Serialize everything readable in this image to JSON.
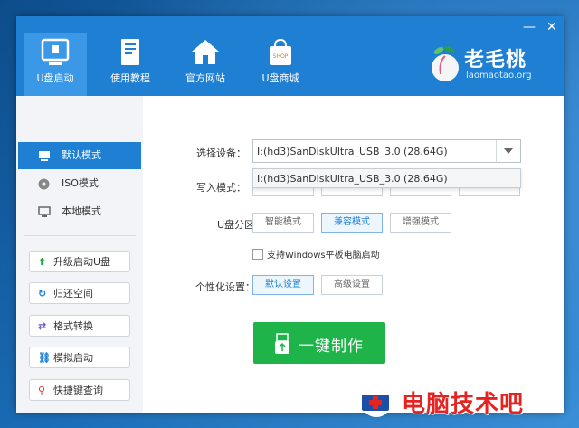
{
  "window": {
    "minimize": "—",
    "close": "✕"
  },
  "nav": [
    {
      "label": "U盘启动",
      "icon": "usb-drive-icon"
    },
    {
      "label": "使用教程",
      "icon": "book-icon"
    },
    {
      "label": "官方网站",
      "icon": "home-icon"
    },
    {
      "label": "U盘商城",
      "icon": "shop-bag-icon"
    }
  ],
  "logo": {
    "name": "老毛桃",
    "url": "laomaotao.org",
    "shop_badge": "SHOP"
  },
  "sidebar": {
    "modes": [
      {
        "label": "默认模式",
        "icon": "usb-mode-icon",
        "active": true
      },
      {
        "label": "ISO模式",
        "icon": "disc-icon",
        "active": false
      },
      {
        "label": "本地模式",
        "icon": "monitor-icon",
        "active": false
      }
    ],
    "tools": [
      {
        "label": "升级启动U盘",
        "icon": "upgrade-arrow-icon",
        "glyph": "⬆",
        "color": "#1fa33a"
      },
      {
        "label": "归还空间",
        "icon": "refresh-icon",
        "glyph": "↻",
        "color": "#1e7fd3"
      },
      {
        "label": "格式转换",
        "icon": "convert-arrows-icon",
        "glyph": "⇄",
        "color": "#6a4fc8"
      },
      {
        "label": "模拟启动",
        "icon": "link-icon",
        "glyph": "⛓",
        "color": "#1e7fd3"
      },
      {
        "label": "快捷键查询",
        "icon": "search-icon",
        "glyph": "⚲",
        "color": "#d9342b"
      }
    ]
  },
  "main": {
    "device_label": "选择设备：",
    "device_value": "I:(hd3)SanDiskUltra_USB_3.0 (28.64G)",
    "device_dropdown_option": "I:(hd3)SanDiskUltra_USB_3.0 (28.64G)",
    "write_mode_label": "写入模式：",
    "partition_label": "U盘分区：",
    "partition_options": [
      "智能模式",
      "兼容模式",
      "增强模式"
    ],
    "partition_selected": "兼容模式",
    "checkbox_label": "支持Windows平板电脑启动",
    "personalize_label": "个性化设置：",
    "personalize_options": [
      "默认设置",
      "高级设置"
    ],
    "personalize_selected": "默认设置",
    "make_button": "一键制作"
  },
  "watermark": {
    "text": "电脑技术吧"
  },
  "colors": {
    "accent": "#1e7fd3",
    "make_green": "#1fb44a",
    "watermark_red": "#e52421"
  }
}
